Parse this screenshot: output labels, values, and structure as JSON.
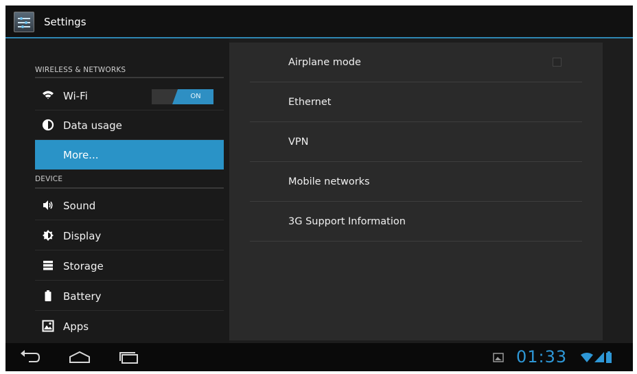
{
  "actionbar": {
    "title": "Settings"
  },
  "sidebar": {
    "sections": [
      {
        "header": "WIRELESS & NETWORKS"
      },
      {
        "header": "DEVICE"
      }
    ],
    "items": [
      {
        "label": "Wi-Fi",
        "icon": "wifi-icon",
        "toggle": "ON"
      },
      {
        "label": "Data usage",
        "icon": "data-usage-icon"
      },
      {
        "label": "More...",
        "selected": true
      },
      {
        "label": "Sound",
        "icon": "speaker-icon"
      },
      {
        "label": "Display",
        "icon": "brightness-icon"
      },
      {
        "label": "Storage",
        "icon": "storage-icon"
      },
      {
        "label": "Battery",
        "icon": "battery-icon"
      },
      {
        "label": "Apps",
        "icon": "apps-icon"
      }
    ]
  },
  "detail": {
    "items": [
      {
        "label": "Airplane mode",
        "checked": false
      },
      {
        "label": "Ethernet"
      },
      {
        "label": "VPN"
      },
      {
        "label": "Mobile networks"
      },
      {
        "label": "3G Support Information"
      }
    ]
  },
  "statusbar": {
    "time": "01:33"
  },
  "colors": {
    "accent": "#2a93c7",
    "background": "#1d1d1d",
    "time_text": "#2e97d6"
  }
}
